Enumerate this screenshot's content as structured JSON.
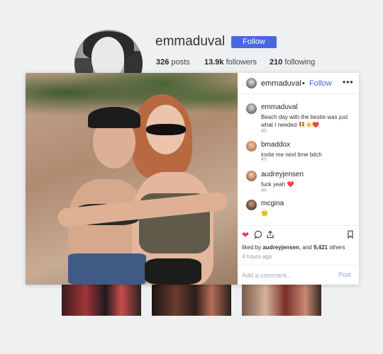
{
  "profile": {
    "username": "emmaduval",
    "follow_label": "Follow",
    "stats": {
      "posts_count": "326",
      "posts_label": "posts",
      "followers_count": "13.9k",
      "followers_label": "followers",
      "following_count": "210",
      "following_label": "following"
    }
  },
  "post": {
    "header": {
      "username": "emmaduval",
      "separator": "•",
      "follow_label": "Follow",
      "more_label": "•••"
    },
    "comments": [
      {
        "username": "emmaduval",
        "text": "Beach day with the bestie was just what I needed 👯☀️❤️",
        "time": "4h"
      },
      {
        "username": "bmaddox",
        "text": "invite me next time bitch",
        "time": "4h"
      },
      {
        "username": "audreyjensen",
        "text": "fuck yeah ❤️",
        "time": "4h"
      },
      {
        "username": "mcgina",
        "text": "😕",
        "time": ""
      }
    ],
    "likes": {
      "prefix": "liked by",
      "user": "audreyjensen",
      "middle": ", and",
      "count": "9,421",
      "suffix": "others"
    },
    "time_ago": "4 hours ago",
    "add_comment_placeholder": "Add a comment...",
    "post_label": "Post",
    "icons": [
      "heart-icon",
      "comment-icon",
      "share-icon",
      "bookmark-icon"
    ]
  },
  "colors": {
    "accent": "#4a67e0",
    "like": "#ec3e57",
    "background": "#eef0f2"
  }
}
